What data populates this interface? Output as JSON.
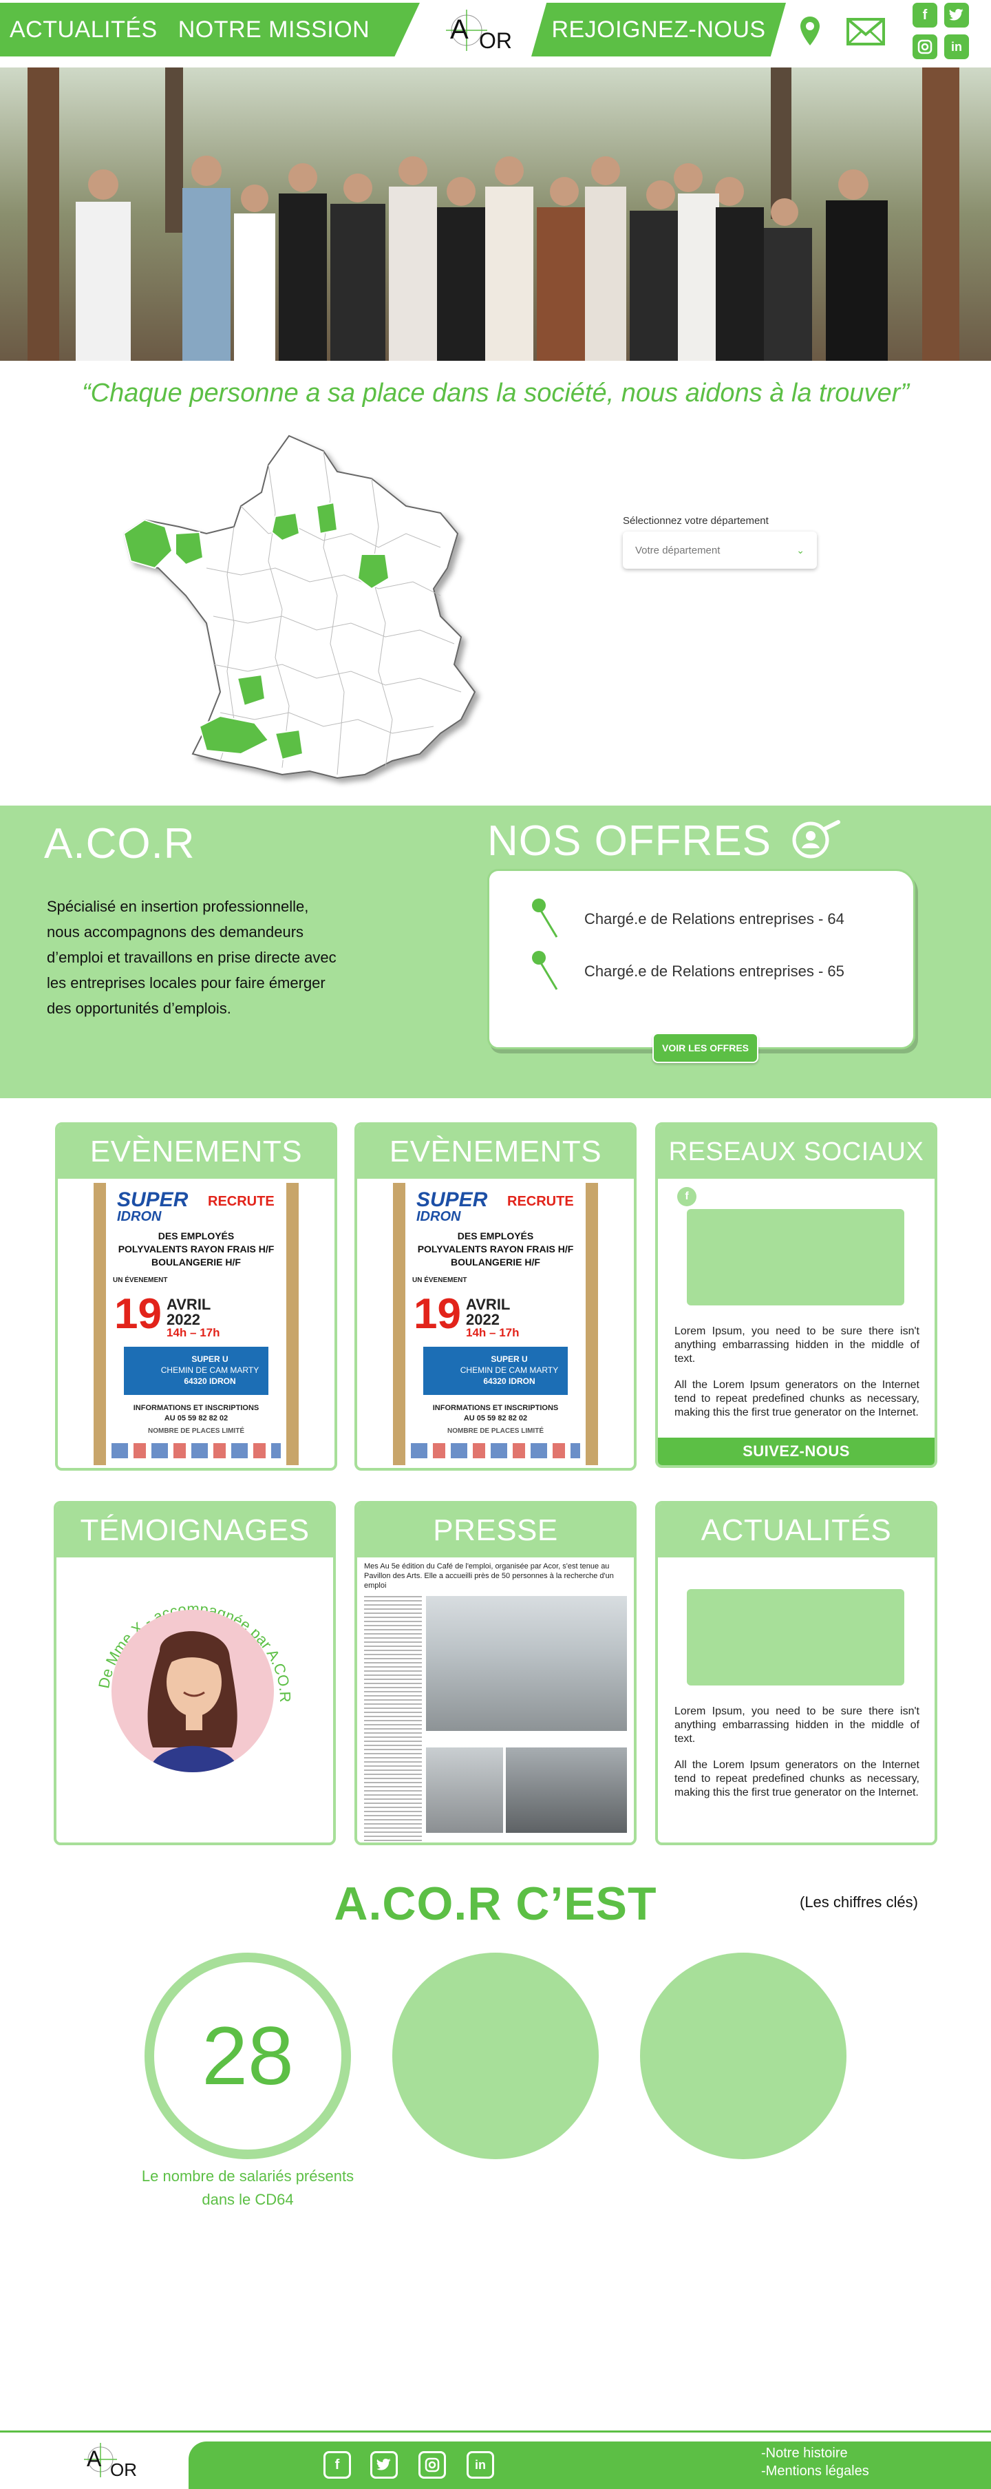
{
  "header": {
    "nav": [
      "ACTUALITÉS",
      "NOTRE MISSION"
    ],
    "join": "REJOIGNEZ-NOUS",
    "logo_text": "ACOR"
  },
  "hero": {
    "alt_icon": "group-photo"
  },
  "quote": "“Chaque personne a sa place dans la société, nous aidons à la trouver”",
  "department": {
    "label": "Sélectionnez votre département",
    "placeholder": "Votre département"
  },
  "about": {
    "title": "A.CO.R",
    "description": "Spécialisé en insertion professionnelle, nous accompagnons des demandeurs d’emploi et travaillons en prise directe avec les entreprises locales pour faire émerger des opportunités d’emplois."
  },
  "offers": {
    "title": "NOS OFFRES",
    "items": [
      "Chargé.e de Relations entreprises - 64",
      "Chargé.e de Relations entreprises - 65"
    ],
    "button": "VOIR LES OFFRES"
  },
  "poster": {
    "brand": "SUPER",
    "brand2": "IDRON",
    "recrute": "RECRUTE",
    "lines": "DES EMPLOYÉS\nPOLYVALENTS RAYON FRAIS H/F\nBOULANGERIE H/F",
    "evt": "UN ÉVENEMENT",
    "day": "19",
    "month": "AVRIL",
    "year": "2022",
    "hours": "14h – 17h",
    "place1": "SUPER U",
    "place2": "CHEMIN DE CAM MARTY",
    "place3": "64320 IDRON",
    "info1": "INFORMATIONS ET INSCRIPTIONS",
    "info2": "AU 05 59 82 82 02",
    "places": "NOMBRE DE PLACES LIMITÉ"
  },
  "cards": {
    "events1": "EVÈNEMENTS",
    "events2": "EVÈNEMENTS",
    "social": "RESEAUX SOCIAUX",
    "testimonials": "TÉMOIGNAGES",
    "press": "PRESSE",
    "news": "ACTUALITÉS",
    "lorem1": "Lorem Ipsum, you need to be sure there isn't anything embarrassing hidden in the middle of text.",
    "lorem2": "All the Lorem Ipsum generators on the Internet tend to repeat predefined chunks as necessary, making this the first true generator on the Internet.",
    "follow": "SUIVEZ-NOUS",
    "testimonial_arc": "De Mme X - accompagnée par A.CO.R TARBES",
    "press_headline": "Mes Au 5e édition du Café de l'emploi, organisée par Acor, s'est tenue au Pavillon des Arts. Elle a accueilli près de 50 personnes à la recherche d'un emploi"
  },
  "key_figures": {
    "title": "A.CO.R C’EST",
    "subtitle": "(Les chiffres clés)",
    "value": "28",
    "label": "Le nombre de salariés présents dans le CD64"
  },
  "footer": {
    "links": [
      "-Notre histoire",
      "-Mentions légales"
    ]
  },
  "colors": {
    "accent": "#5cbf45",
    "light": "#a7df99"
  }
}
